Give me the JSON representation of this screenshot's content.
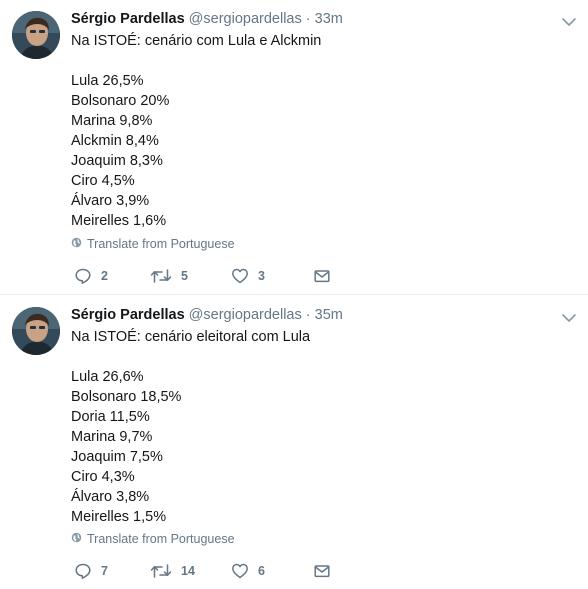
{
  "tweets": [
    {
      "author_name": "Sérgio Pardellas",
      "author_handle": "@sergiopardellas",
      "separator": "·",
      "time": "33m",
      "lines": [
        "Na ISTOÉ: cenário com Lula e Alckmin",
        "",
        "Lula 26,5%",
        "Bolsonaro 20%",
        "Marina 9,8%",
        "Alckmin 8,4%",
        "Joaquim 8,3%",
        "Ciro 4,5%",
        "Álvaro 3,9%",
        "Meirelles 1,6%"
      ],
      "translate_label": "Translate from Portuguese",
      "reply_count": "2",
      "retweet_count": "5",
      "like_count": "3"
    },
    {
      "author_name": "Sérgio Pardellas",
      "author_handle": "@sergiopardellas",
      "separator": "·",
      "time": "35m",
      "lines": [
        "Na ISTOÉ: cenário eleitoral com Lula",
        "",
        "Lula 26,6%",
        "Bolsonaro 18,5%",
        "Doria 11,5%",
        "Marina 9,7%",
        "Joaquim 7,5%",
        "Ciro 4,3%",
        "Álvaro 3,8%",
        "Meirelles 1,5%"
      ],
      "translate_label": "Translate from Portuguese",
      "reply_count": "7",
      "retweet_count": "14",
      "like_count": "6"
    }
  ],
  "colors": {
    "text": "#14171a",
    "muted": "#657786",
    "divider": "#e6ecf0"
  },
  "icons": {
    "globe": "globe-icon",
    "reply": "reply-icon",
    "retweet": "retweet-icon",
    "like": "heart-icon",
    "dm": "envelope-icon",
    "menu": "chevron-down-icon"
  }
}
